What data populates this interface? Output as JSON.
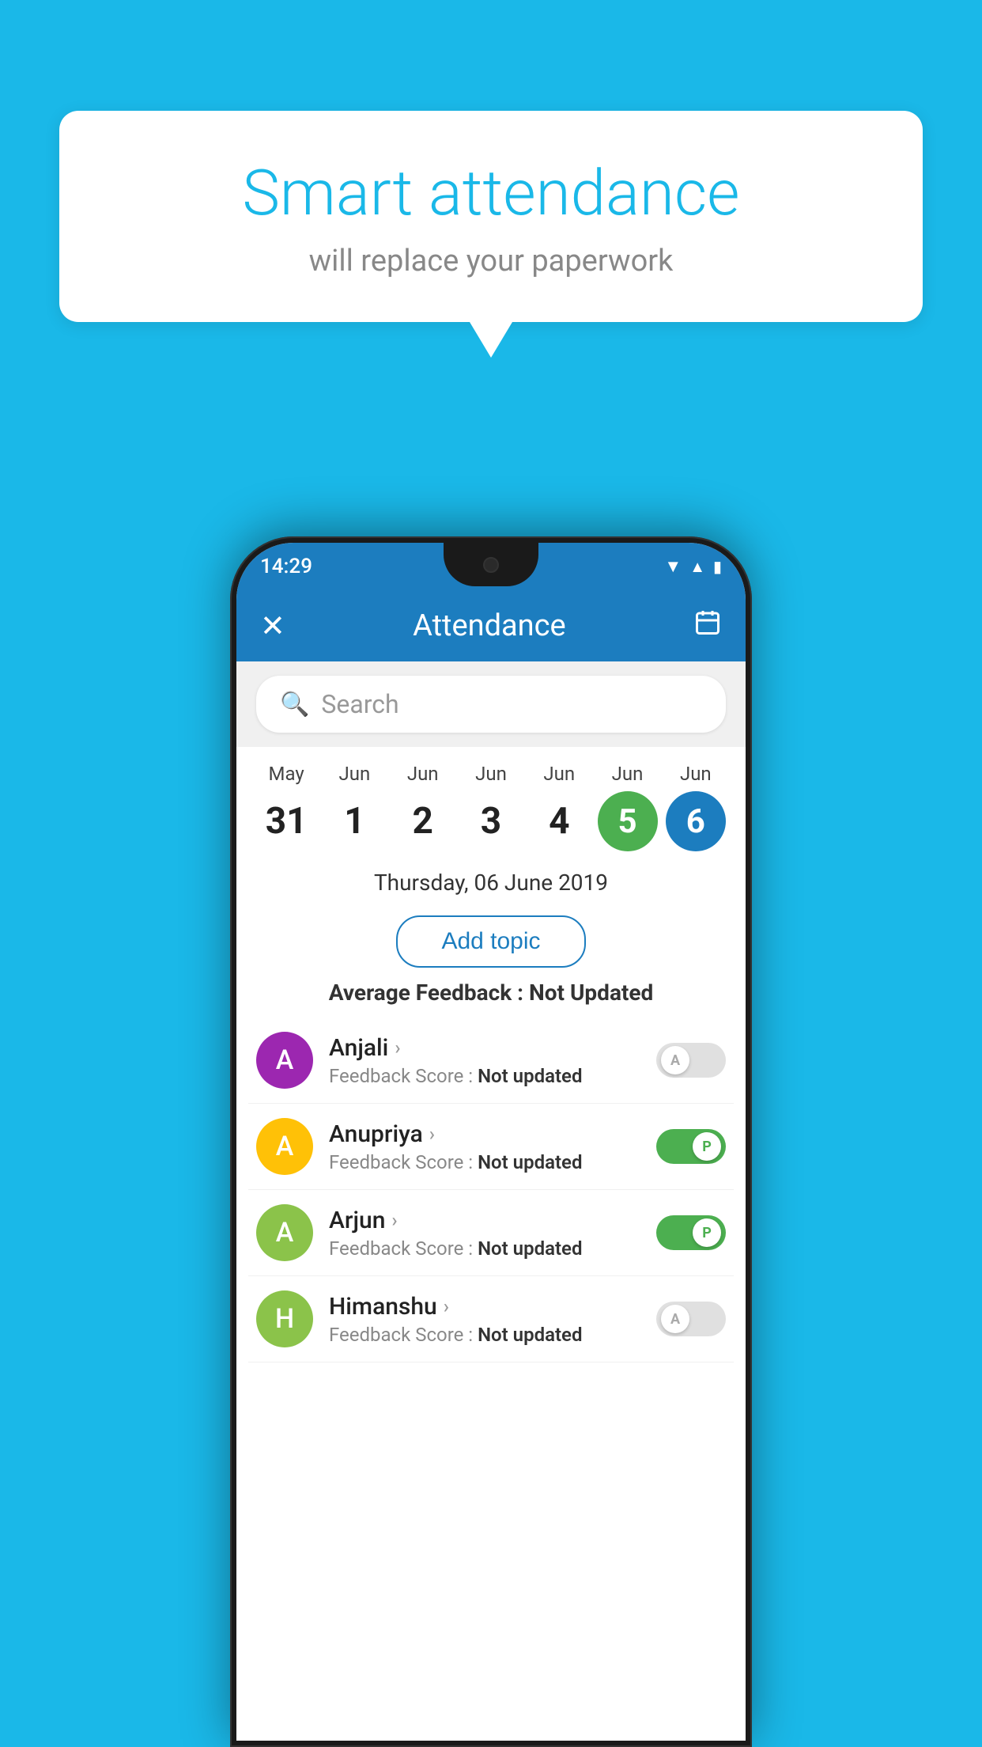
{
  "background_color": "#1AB8E8",
  "speech_bubble": {
    "title": "Smart attendance",
    "subtitle": "will replace your paperwork"
  },
  "phone": {
    "status_bar": {
      "time": "14:29",
      "wifi_icon": "wifi-icon",
      "signal_icon": "signal-icon",
      "battery_icon": "battery-icon"
    },
    "header": {
      "close_label": "✕",
      "title": "Attendance",
      "calendar_icon": "calendar-icon"
    },
    "search": {
      "placeholder": "Search",
      "search_icon": "search-icon"
    },
    "calendar": {
      "days": [
        {
          "month": "May",
          "date": "31",
          "state": "normal"
        },
        {
          "month": "Jun",
          "date": "1",
          "state": "normal"
        },
        {
          "month": "Jun",
          "date": "2",
          "state": "normal"
        },
        {
          "month": "Jun",
          "date": "3",
          "state": "normal"
        },
        {
          "month": "Jun",
          "date": "4",
          "state": "normal"
        },
        {
          "month": "Jun",
          "date": "5",
          "state": "today"
        },
        {
          "month": "Jun",
          "date": "6",
          "state": "selected"
        }
      ]
    },
    "selected_date": "Thursday, 06 June 2019",
    "add_topic_label": "Add topic",
    "average_feedback": {
      "label": "Average Feedback : ",
      "value": "Not Updated"
    },
    "students": [
      {
        "name": "Anjali",
        "avatar_letter": "A",
        "avatar_color": "#9C27B0",
        "feedback_label": "Feedback Score : ",
        "feedback_value": "Not updated",
        "toggle_state": "off",
        "toggle_label": "A"
      },
      {
        "name": "Anupriya",
        "avatar_letter": "A",
        "avatar_color": "#FFC107",
        "feedback_label": "Feedback Score : ",
        "feedback_value": "Not updated",
        "toggle_state": "on",
        "toggle_label": "P"
      },
      {
        "name": "Arjun",
        "avatar_letter": "A",
        "avatar_color": "#8BC34A",
        "feedback_label": "Feedback Score : ",
        "feedback_value": "Not updated",
        "toggle_state": "on",
        "toggle_label": "P"
      },
      {
        "name": "Himanshu",
        "avatar_letter": "H",
        "avatar_color": "#8BC34A",
        "feedback_label": "Feedback Score : ",
        "feedback_value": "Not updated",
        "toggle_state": "off",
        "toggle_label": "A"
      }
    ]
  }
}
